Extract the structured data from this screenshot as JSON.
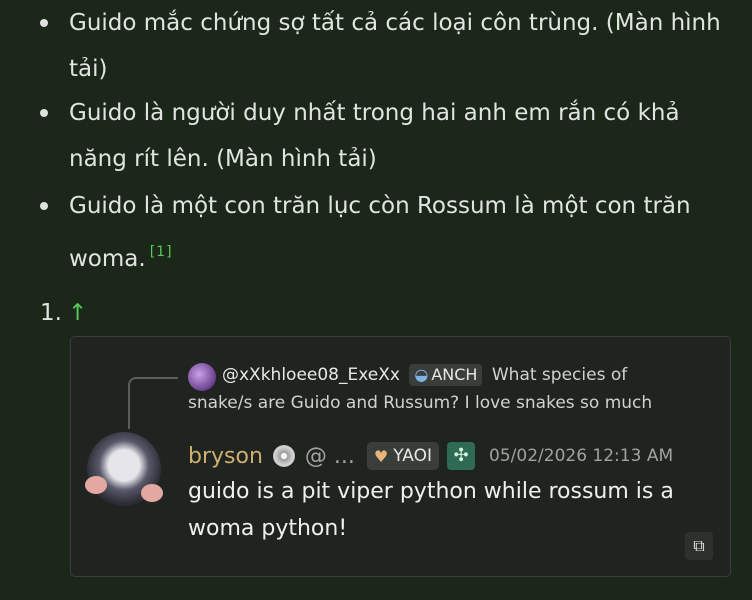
{
  "bullets": [
    {
      "text": "Guido mắc chứng sợ tất cả các loại côn trùng. (Màn hình tải)"
    },
    {
      "text": "Guido là người duy nhất trong hai anh em rắn có khả năng rít lên. (Màn hình tải)"
    },
    {
      "text": "Guido là một con trăn lục còn Rossum là một con trăn woma.",
      "footnote": "[1]"
    }
  ],
  "ordered": {
    "marker": "1.",
    "arrow": "↑"
  },
  "embed": {
    "reply": {
      "username": "@xXkhloee08_ExeXx",
      "tag": "ANCH",
      "text": "What species of snake/s are Guido and Russum? I love snakes so much"
    },
    "author": "bryson",
    "handle": "@ ...",
    "role_badge": "YAOI",
    "timestamp": "05/02/2026 12:13 AM",
    "message": "guido is a pit viper python while rossum is a woma python!"
  },
  "colors": {
    "accent": "#57c85a",
    "author": "#cfae6f",
    "background": "#1a2719"
  },
  "icons": [
    "cd-disc-icon",
    "heart-icon",
    "fan-icon",
    "copy-icon"
  ]
}
